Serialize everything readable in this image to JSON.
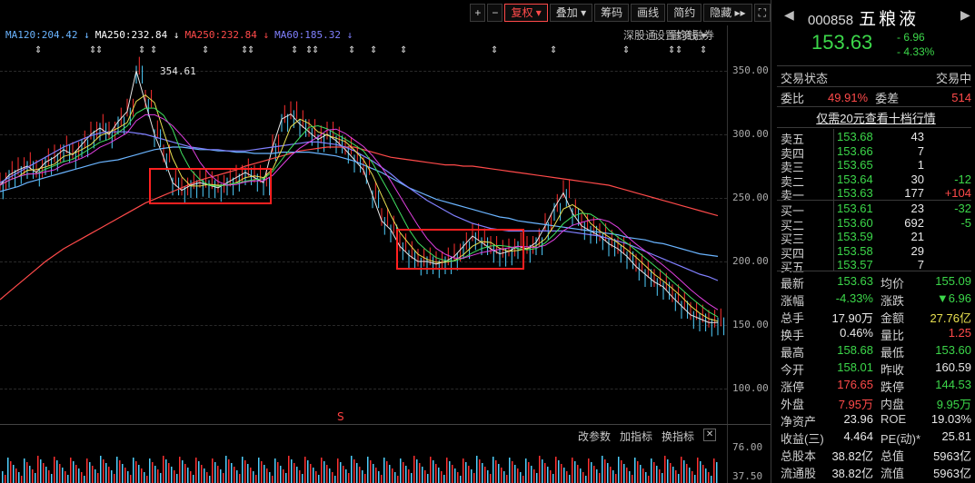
{
  "toolbar": {
    "buttons": [
      "+",
      "−",
      "复权 ▾",
      "叠加 ▾",
      "筹码",
      "画线",
      "简约",
      "隐藏 ▸▸",
      "⛶"
    ]
  },
  "ma_legend": [
    {
      "label": "MA120:204.42 ↓",
      "color": "#6ab4ff"
    },
    {
      "label": "MA250:232.84 ↓",
      "color": "#ffffff"
    },
    {
      "label": "MA250:232.84 ↓",
      "color": "#ff4a4a"
    },
    {
      "label": "MA60:185.32 ↓",
      "color": "#8080ff"
    }
  ],
  "chart_tools": [
    "深股通",
    "融资融券",
    "设置均线 ▾"
  ],
  "indicator_tools": [
    "改参数",
    "加指标",
    "换指标",
    "✕"
  ],
  "peak_label": "354.61",
  "red_marker": "S",
  "chart_data": {
    "type": "line",
    "ylim": [
      100,
      350
    ],
    "yticks": [
      "350.00",
      "300.00",
      "250.00",
      "200.00",
      "150.00",
      "100.00"
    ],
    "volume_ticks": [
      "76.00",
      "37.50"
    ],
    "x": [
      0,
      10,
      20,
      30,
      40,
      50,
      60,
      70,
      80,
      90,
      100,
      110,
      120,
      130,
      140,
      150,
      160,
      170,
      180,
      190,
      200,
      210,
      220,
      230,
      240,
      250,
      260,
      270,
      280,
      290,
      300,
      310,
      320,
      330,
      340,
      350,
      360,
      370,
      380,
      390,
      400,
      410,
      420,
      430,
      440,
      450,
      460,
      470,
      480,
      490,
      500,
      510,
      520,
      530,
      540,
      550,
      560,
      570,
      580,
      590,
      600,
      610,
      620,
      630,
      640,
      650,
      660,
      670,
      680,
      690,
      700,
      710,
      720,
      730,
      740,
      750,
      760,
      770,
      780,
      790
    ],
    "series": [
      {
        "values": [
          260,
          268,
          272,
          275,
          270,
          278,
          282,
          288,
          284,
          292,
          300,
          305,
          300,
          310,
          318,
          350,
          325,
          300,
          282,
          262,
          256,
          260,
          262,
          260,
          258,
          262,
          266,
          270,
          266,
          262,
          290,
          312,
          316,
          308,
          302,
          296,
          300,
          295,
          288,
          280,
          272,
          252,
          232,
          225,
          212,
          205,
          200,
          200,
          198,
          200,
          204,
          212,
          220,
          215,
          210,
          206,
          208,
          212,
          210,
          215,
          228,
          242,
          254,
          238,
          228,
          224,
          220,
          214,
          210,
          204,
          196,
          190,
          184,
          180,
          172,
          165,
          158,
          155,
          152,
          152
        ]
      },
      {
        "values": [
          170,
          176,
          182,
          188,
          194,
          200,
          205,
          210,
          214,
          218,
          222,
          226,
          230,
          234,
          238,
          242,
          246,
          249,
          252,
          255,
          258,
          261,
          264,
          266,
          268,
          270,
          272,
          275,
          277,
          279,
          281,
          283,
          285,
          287,
          288,
          289,
          290,
          290,
          290,
          290,
          288,
          286,
          284,
          282,
          281,
          280,
          279,
          278,
          277,
          276,
          276,
          275,
          275,
          274,
          273,
          272,
          271,
          270,
          269,
          268,
          267,
          266,
          265,
          264,
          263,
          262,
          261,
          260,
          258,
          256,
          254,
          252,
          250,
          248,
          246,
          244,
          242,
          240,
          238,
          236
        ]
      },
      {
        "values": [
          255,
          257,
          259,
          262,
          264,
          266,
          268,
          270,
          272,
          274,
          276,
          278,
          279,
          280,
          282,
          284,
          286,
          288,
          289,
          290,
          290,
          289,
          288,
          288,
          287,
          287,
          286,
          286,
          285,
          285,
          285,
          286,
          286,
          286,
          286,
          285,
          284,
          283,
          281,
          279,
          276,
          273,
          270,
          266,
          262,
          258,
          255,
          252,
          249,
          247,
          245,
          243,
          241,
          239,
          237,
          235,
          234,
          232,
          231,
          230,
          229,
          228,
          227,
          226,
          225,
          224,
          223,
          222,
          221,
          219,
          218,
          217,
          215,
          214,
          212,
          210,
          208,
          206,
          205,
          204
        ]
      },
      {
        "values": [
          262,
          266,
          270,
          274,
          278,
          282,
          286,
          290,
          293,
          296,
          299,
          301,
          302,
          302,
          302,
          301,
          300,
          298,
          296,
          294,
          292,
          290,
          289,
          288,
          288,
          287,
          287,
          287,
          288,
          289,
          290,
          291,
          292,
          293,
          294,
          294,
          293,
          292,
          290,
          287,
          283,
          279,
          274,
          269,
          263,
          258,
          253,
          248,
          244,
          240,
          236,
          233,
          230,
          228,
          226,
          225,
          224,
          224,
          224,
          224,
          224,
          224,
          224,
          223,
          222,
          221,
          220,
          218,
          216,
          214,
          211,
          208,
          205,
          202,
          199,
          196,
          193,
          190,
          188,
          185
        ]
      }
    ]
  },
  "panel": {
    "code": "000858",
    "name": "五粮液",
    "price": "153.63",
    "change": "- 6.96",
    "change_pct": "- 4.33%",
    "status_label": "交易状态",
    "status_value": "交易中",
    "weibi_label": "委比",
    "weibi_value": "49.91%",
    "weicha_label": "委差",
    "weicha_value": "514",
    "promo": "仅需20元查看十档行情",
    "asks": [
      {
        "label": "卖五",
        "price": "153.68",
        "vol": "43",
        "chg": ""
      },
      {
        "label": "卖四",
        "price": "153.66",
        "vol": "7",
        "chg": ""
      },
      {
        "label": "卖三",
        "price": "153.65",
        "vol": "1",
        "chg": ""
      },
      {
        "label": "卖二",
        "price": "153.64",
        "vol": "30",
        "chg": "-12"
      },
      {
        "label": "卖一",
        "price": "153.63",
        "vol": "177",
        "chg": "+104"
      }
    ],
    "bids": [
      {
        "label": "买一",
        "price": "153.61",
        "vol": "23",
        "chg": "-32"
      },
      {
        "label": "买二",
        "price": "153.60",
        "vol": "692",
        "chg": "-5"
      },
      {
        "label": "买三",
        "price": "153.59",
        "vol": "21",
        "chg": ""
      },
      {
        "label": "买四",
        "price": "153.58",
        "vol": "29",
        "chg": ""
      },
      {
        "label": "买五",
        "price": "153.57",
        "vol": "7",
        "chg": ""
      }
    ],
    "stats": [
      [
        "最新",
        "153.63",
        "g",
        "均价",
        "155.09",
        "g"
      ],
      [
        "涨幅",
        "-4.33%",
        "g",
        "涨跌",
        "▼6.96",
        "g"
      ],
      [
        "总手",
        "17.90万",
        "w",
        "金额",
        "27.76亿",
        "y"
      ],
      [
        "换手",
        "0.46%",
        "w",
        "量比",
        "1.25",
        "r"
      ],
      [
        "最高",
        "158.68",
        "g",
        "最低",
        "153.60",
        "g"
      ],
      [
        "今开",
        "158.01",
        "g",
        "昨收",
        "160.59",
        "w"
      ],
      [
        "涨停",
        "176.65",
        "r",
        "跌停",
        "144.53",
        "g"
      ],
      [
        "外盘",
        "7.95万",
        "r",
        "内盘",
        "9.95万",
        "g"
      ],
      [
        "净资产",
        "23.96",
        "w",
        "ROE",
        "19.03%",
        "w"
      ],
      [
        "收益(三)",
        "4.464",
        "w",
        "PE(动)*",
        "25.81",
        "w"
      ],
      [
        "总股本",
        "38.82亿",
        "w",
        "总值",
        "5963亿",
        "w"
      ],
      [
        "流通股",
        "38.82亿",
        "w",
        "流值",
        "5963亿",
        "w"
      ]
    ]
  }
}
